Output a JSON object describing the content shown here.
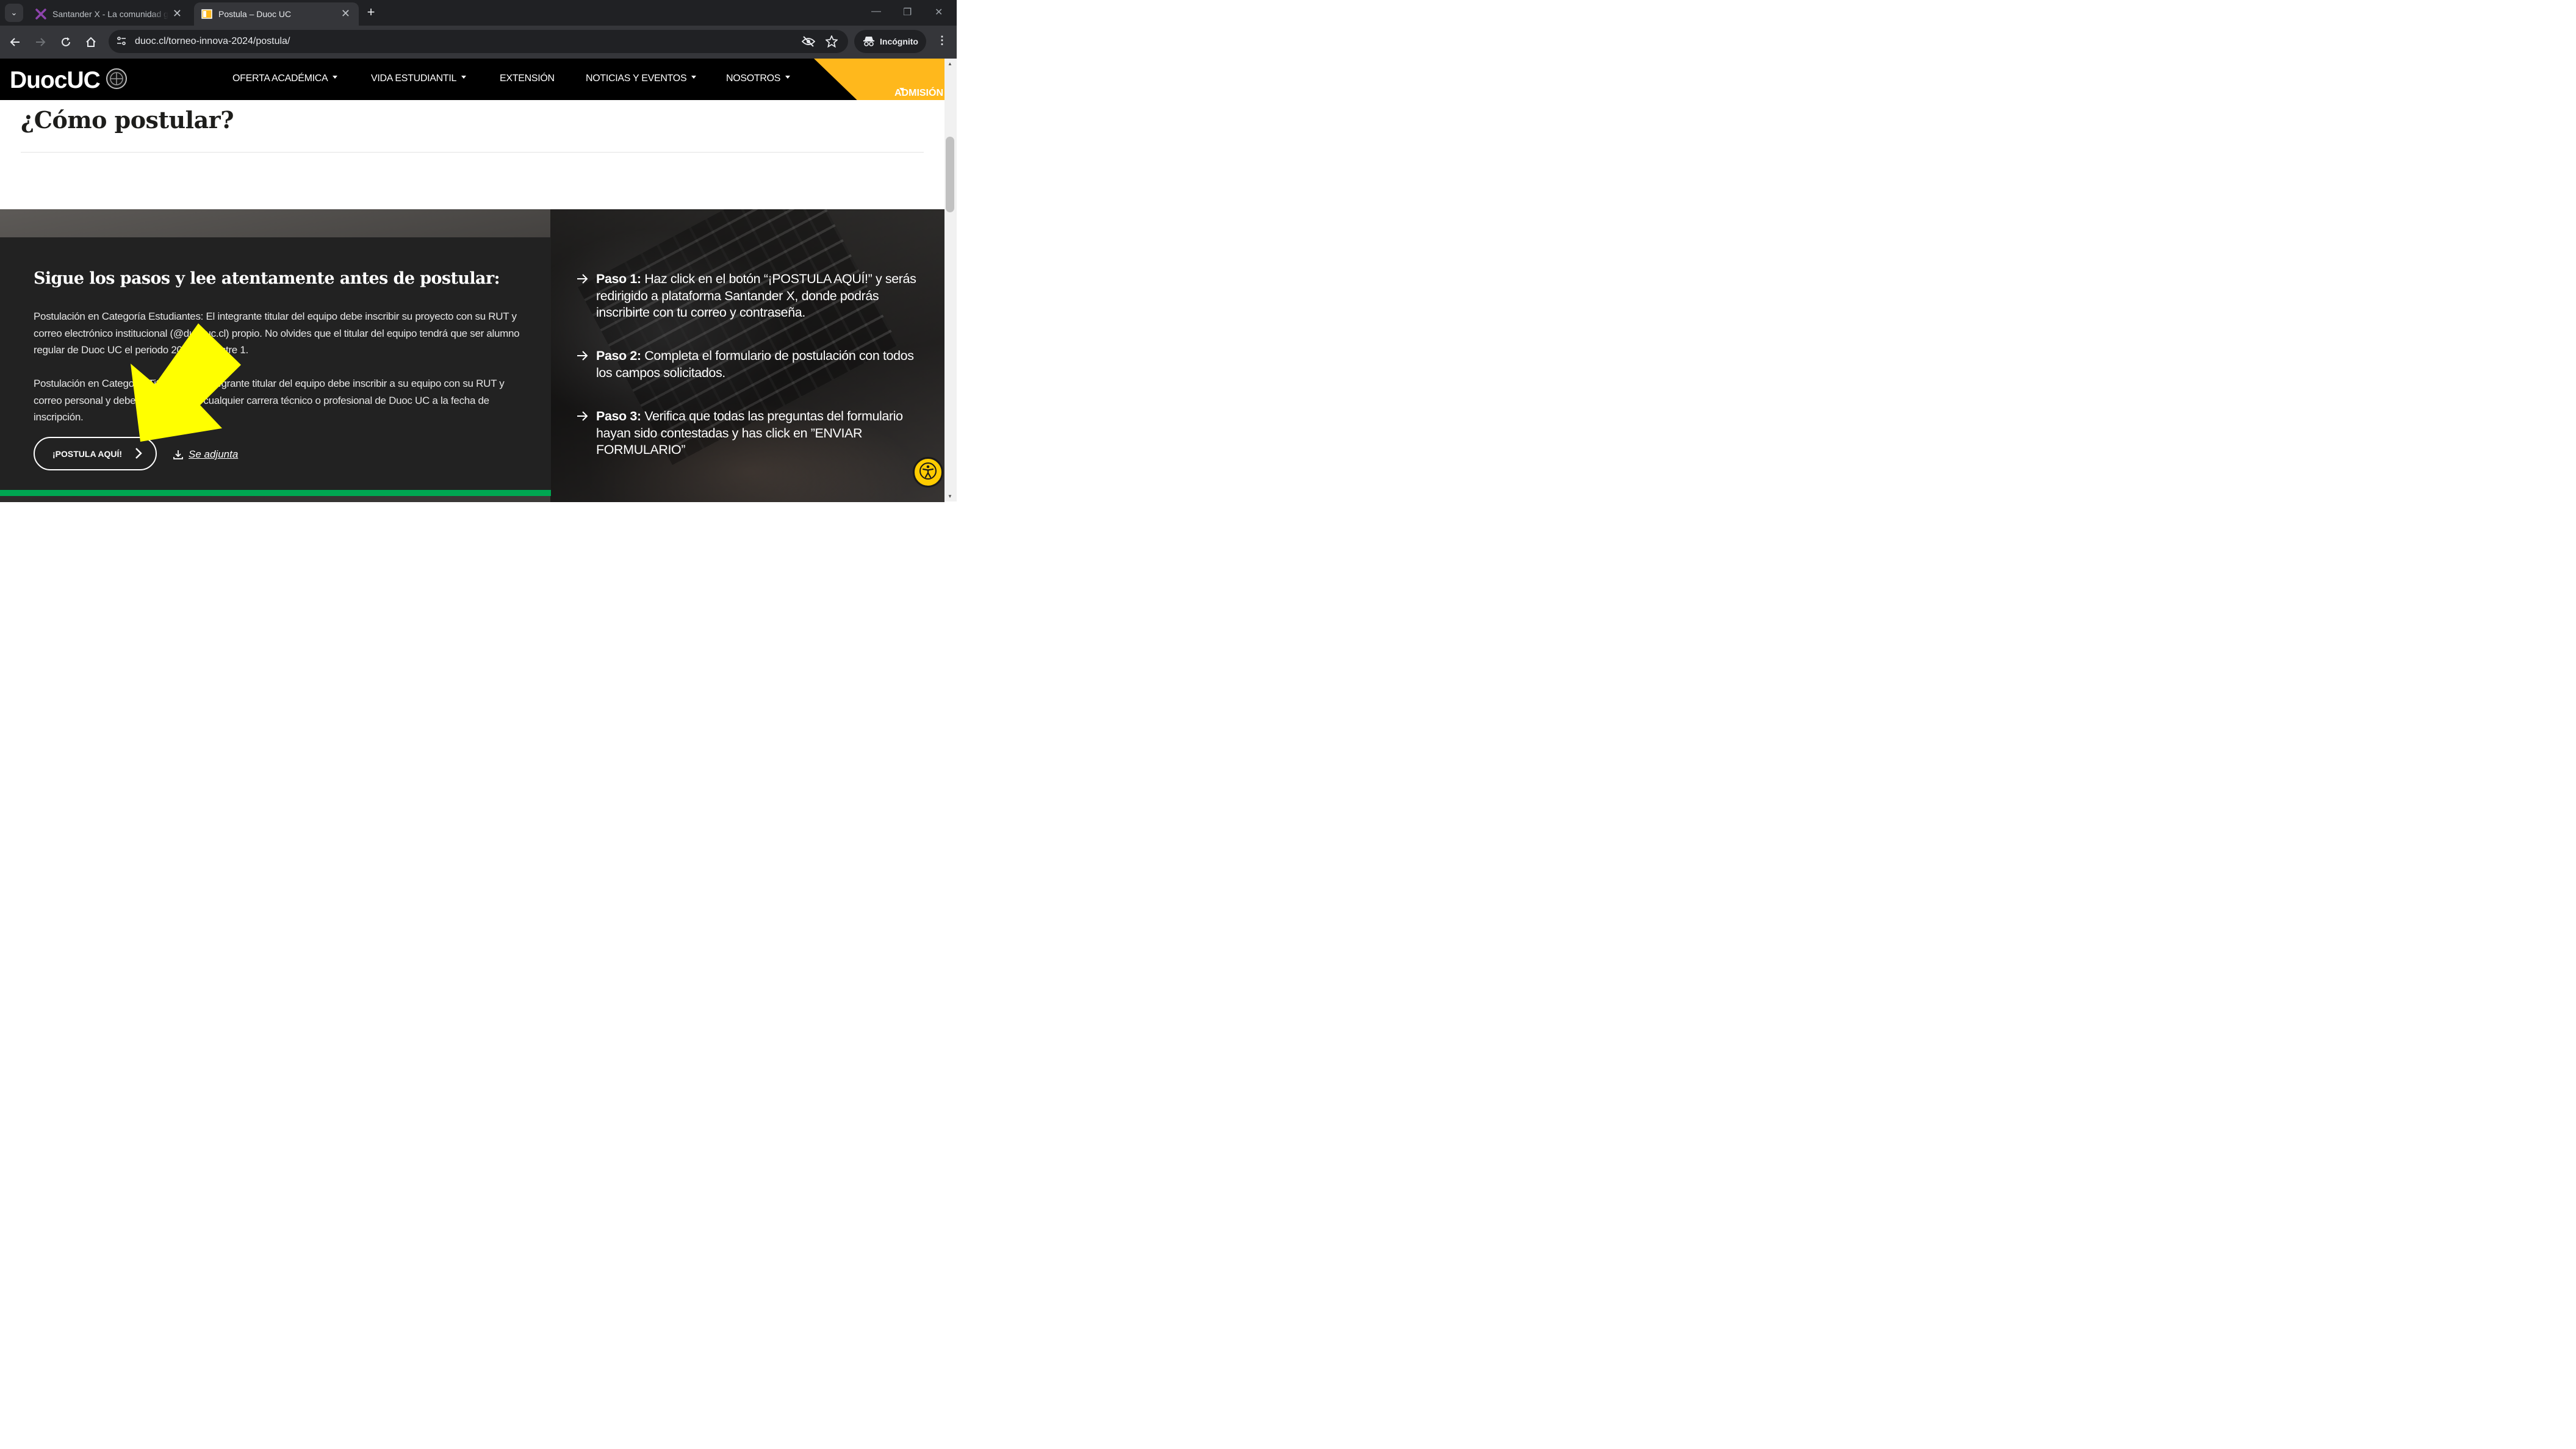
{
  "browser": {
    "tabs": [
      {
        "title": "Santander X - La comunidad global",
        "active": false
      },
      {
        "title": "Postula – Duoc UC",
        "active": true
      }
    ],
    "url": "duoc.cl/torneo-innova-2024/postula/",
    "incognito_label": "Incógnito"
  },
  "site": {
    "logo_text": "DuocUC",
    "nav": [
      {
        "label": "OFERTA ACADÉMICA",
        "has_dropdown": true
      },
      {
        "label": "VIDA ESTUDIANTIL",
        "has_dropdown": true
      },
      {
        "label": "EXTENSIÓN",
        "has_dropdown": false
      },
      {
        "label": "NOTICIAS Y EVENTOS",
        "has_dropdown": true
      },
      {
        "label": "NOSOTROS",
        "has_dropdown": true
      }
    ],
    "admission_label": "ADMISIÓN",
    "colors": {
      "header": "#000000",
      "admission": "#ffb81c",
      "card": "#222222",
      "accent_green": "#00a651"
    }
  },
  "page": {
    "heading": "¿Cómo postular?",
    "card": {
      "title": "Sigue los pasos y lee atentamente antes de postular:",
      "para1": "Postulación en Categoría Estudiantes: El integrante titular del equipo debe inscribir su proyecto con su RUT y correo electrónico institucional (@duocuc.cl) propio. No olvides que el titular del equipo tendrá que ser alumno regular de Duoc UC el periodo 2024 semestre 1.",
      "para2": "Postulación en Categoría Titulados: El integrante titular del equipo debe inscribir a su equipo con su RUT y correo personal y debe ser titulado de cualquier carrera técnico o profesional de Duoc UC a la fecha de inscripción.",
      "button_label": "¡POSTULA AQUÍ!",
      "attachment_label": "Se adjunta"
    },
    "steps": [
      {
        "label": "Paso 1:",
        "text": " Haz click en el botón “¡POSTULA AQUÍ!” y serás redirigido a plataforma Santander X, donde podrás inscribirte con tu correo y contraseña."
      },
      {
        "label": "Paso 2:",
        "text": " Completa el formulario de postulación con todos los campos solicitados."
      },
      {
        "label": "Paso 3:",
        "text": " Verifica que todas las preguntas del formulario hayan sido contestadas y has click en ”ENVIAR FORMULARIO”"
      }
    ]
  },
  "annotation": {
    "arrow_color": "#ffff00"
  }
}
